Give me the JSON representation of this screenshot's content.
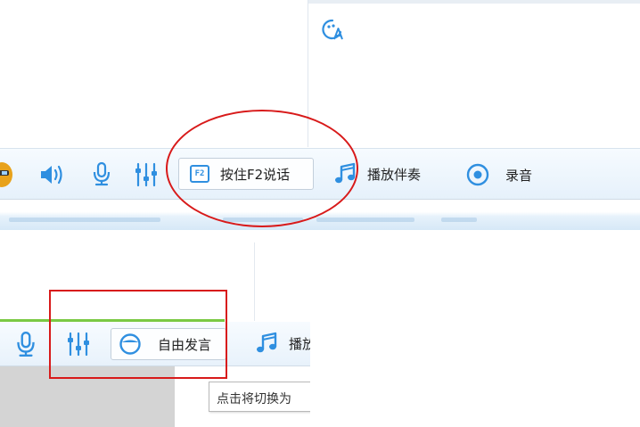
{
  "top_panel": {
    "toolbar": {
      "push_to_talk_label": "按住F2说话",
      "push_to_talk_key": "F2",
      "play_accompaniment_label": "播放伴奏",
      "record_label": "录音"
    }
  },
  "bottom_panel": {
    "toolbar": {
      "free_speech_label": "自由发言",
      "play_accompaniment_partial_label": "播放"
    },
    "tooltip": "点击将切换为"
  },
  "icons": {
    "avatar": "avatar-icon",
    "volume": "speaker-icon",
    "microphone": "microphone-icon",
    "mixer": "equalizer-icon",
    "music": "music-note-icon",
    "record": "record-icon",
    "font": "font-icon",
    "smile": "smile-icon"
  },
  "colors": {
    "icon_blue": "#2f8fe0",
    "annotation_red": "#d81a1a",
    "accent_green": "#7ac943",
    "toolbar_bg": "#eef5fc"
  }
}
